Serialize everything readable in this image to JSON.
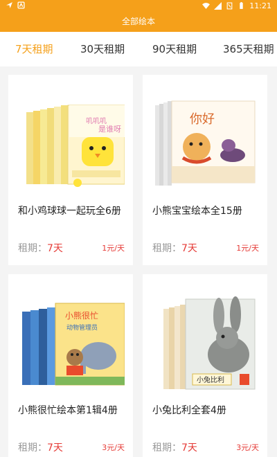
{
  "status_bar": {
    "time": "11:21"
  },
  "header": {
    "title": "全部绘本"
  },
  "tabs": [
    {
      "label": "7天租期",
      "active": true
    },
    {
      "label": "30天租期",
      "active": false
    },
    {
      "label": "90天租期",
      "active": false
    },
    {
      "label": "365天租期",
      "active": false
    }
  ],
  "rent_label": "租期：",
  "books": [
    {
      "name": "和小鸡球球一起玩全6册",
      "days": "7天",
      "price": "1元/天",
      "cover_text": "叽叽叽，是谁呀？"
    },
    {
      "name": "小熊宝宝绘本全15册",
      "days": "7天",
      "price": "1元/天",
      "cover_text": "你好"
    },
    {
      "name": "小熊很忙绘本第1辑4册",
      "days": "7天",
      "price": "3元/天",
      "cover_text": "小熊很忙 动物管理员"
    },
    {
      "name": "小兔比利全套4册",
      "days": "7天",
      "price": "3元/天",
      "cover_text": "小兔比利"
    }
  ],
  "colors": {
    "accent": "#f5a01a",
    "price": "#e53935"
  }
}
